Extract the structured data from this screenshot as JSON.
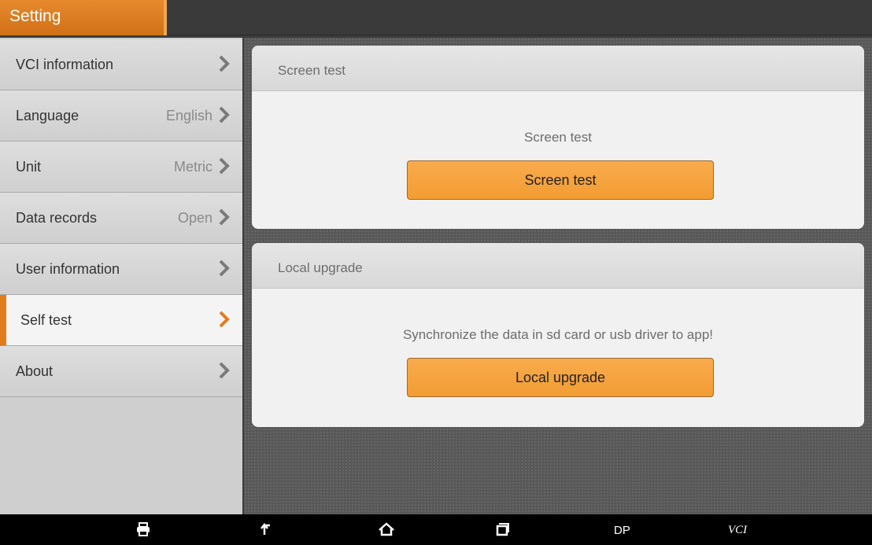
{
  "app": {
    "title": "Setting"
  },
  "sidebar": {
    "items": [
      {
        "label": "VCI information",
        "value": ""
      },
      {
        "label": "Language",
        "value": "English"
      },
      {
        "label": "Unit",
        "value": "Metric"
      },
      {
        "label": "Data records",
        "value": "Open"
      },
      {
        "label": "User information",
        "value": ""
      },
      {
        "label": "Self test",
        "value": "",
        "active": true
      },
      {
        "label": "About",
        "value": ""
      }
    ]
  },
  "cards": {
    "screen_test": {
      "header": "Screen test",
      "description": "Screen test",
      "button": "Screen test"
    },
    "local_upgrade": {
      "header": "Local upgrade",
      "description": "Synchronize the data in sd card or usb driver to app!",
      "button": "Local upgrade"
    }
  },
  "navbar": {
    "icons": [
      "print-icon",
      "back-icon",
      "home-icon",
      "recent-apps-icon"
    ],
    "dp_label": "DP",
    "vci_label": "VCI"
  },
  "colors": {
    "accent": "#e27c1a",
    "button": "#f6a33f",
    "title_bar": "#d9771f"
  }
}
